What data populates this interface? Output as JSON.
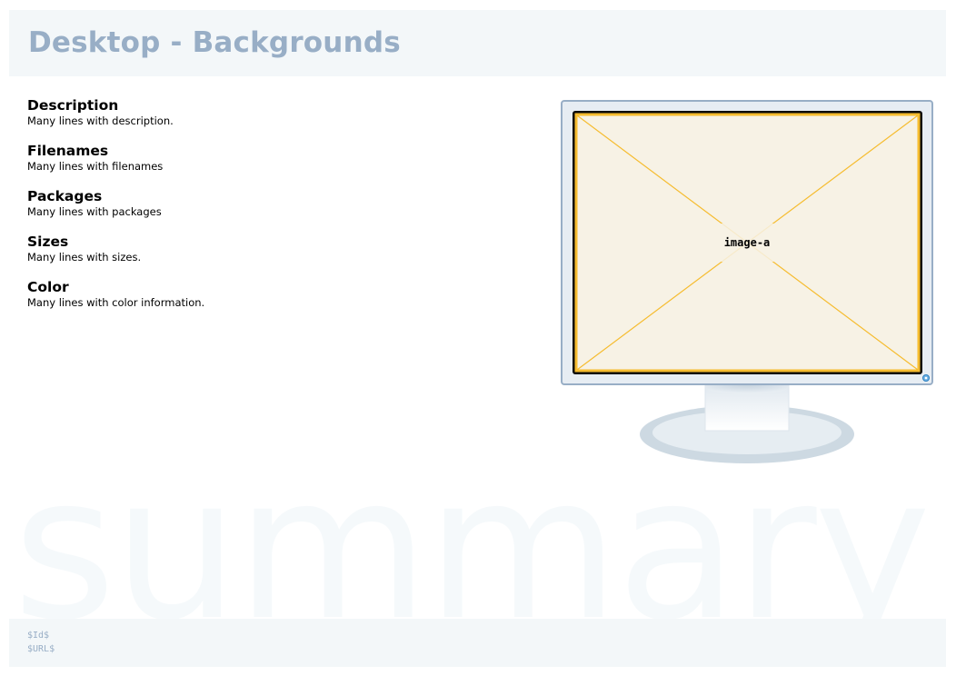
{
  "header": {
    "title": "Desktop - Backgrounds"
  },
  "sections": [
    {
      "heading": "Description",
      "text": "Many lines with description."
    },
    {
      "heading": "Filenames",
      "text": "Many lines with filenames"
    },
    {
      "heading": "Packages",
      "text": "Many lines with packages"
    },
    {
      "heading": "Sizes",
      "text": "Many lines with sizes."
    },
    {
      "heading": "Color",
      "text": "Many lines with color information."
    }
  ],
  "monitor": {
    "screen_label": "image-a"
  },
  "watermark": {
    "text": "summary"
  },
  "footer": {
    "id_line": "$Id$",
    "url_line": "$URL$"
  },
  "colors": {
    "header_bg": "#f3f7f9",
    "title": "#98aec6",
    "screen_bg": "#f7f2e5",
    "screen_border": "#f6bc2f",
    "bezel": "#e7edf3"
  }
}
